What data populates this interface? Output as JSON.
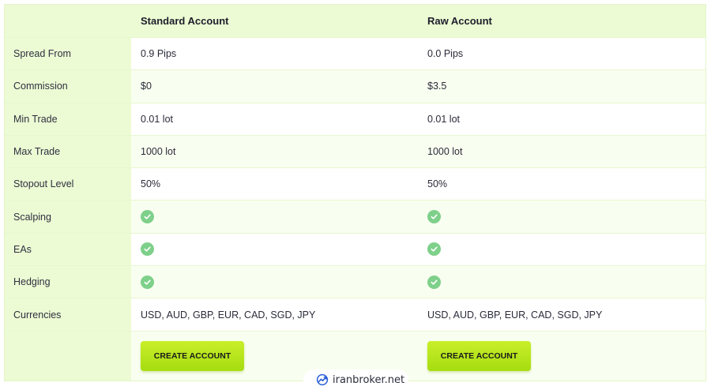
{
  "header": {
    "standard": "Standard Account",
    "raw": "Raw Account"
  },
  "rows": [
    {
      "label": "Spread From",
      "standard": "0.9 Pips",
      "raw": "0.0 Pips"
    },
    {
      "label": "Commission",
      "standard": "$0",
      "raw": "$3.5"
    },
    {
      "label": "Min Trade",
      "standard": "0.01 lot",
      "raw": "0.01 lot"
    },
    {
      "label": "Max Trade",
      "standard": "1000 lot",
      "raw": "1000 lot"
    },
    {
      "label": "Stopout Level",
      "standard": "50%",
      "raw": "50%"
    },
    {
      "label": "Scalping",
      "standard_icon": "check-icon",
      "raw_icon": "check-icon"
    },
    {
      "label": "EAs",
      "standard_icon": "check-icon",
      "raw_icon": "check-icon"
    },
    {
      "label": "Hedging",
      "standard_icon": "check-icon",
      "raw_icon": "check-icon"
    },
    {
      "label": "Currencies",
      "standard": "USD, AUD, GBP, EUR, CAD, SGD, JPY",
      "raw": "USD, AUD, GBP, EUR, CAD, SGD, JPY"
    }
  ],
  "actions": {
    "standard_button": "CREATE ACCOUNT",
    "raw_button": "CREATE ACCOUNT"
  },
  "watermark": {
    "text": "iranbroker.net",
    "icon": "trend-logo-icon"
  },
  "colors": {
    "label_bg": "#ecfbd3",
    "alt_row_bg": "#f9fff0",
    "check_green": "#7ed08a",
    "button_lime": "#b8e61c"
  }
}
